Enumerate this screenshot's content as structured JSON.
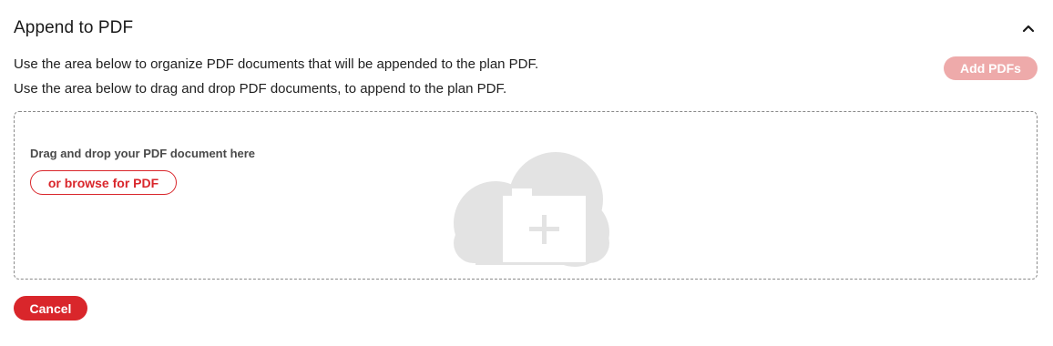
{
  "section": {
    "title": "Append to PDF",
    "collapse_icon": "chevron-up-icon"
  },
  "descriptions": {
    "line1": "Use the area below to organize PDF documents that will be appended to the plan PDF.",
    "line2": "Use the area below to drag and drop PDF documents, to append to the plan PDF."
  },
  "actions": {
    "add_pdfs_label": "Add PDFs",
    "add_pdfs_disabled": true,
    "cancel_label": "Cancel"
  },
  "dropzone": {
    "label": "Drag and drop your PDF document here",
    "browse_label": "or browse for PDF",
    "illustration_icon": "cloud-upload-icon"
  },
  "colors": {
    "accent": "#d9262b",
    "accent_disabled": "#eeaaaa",
    "illustration": "#e3e3e3"
  }
}
